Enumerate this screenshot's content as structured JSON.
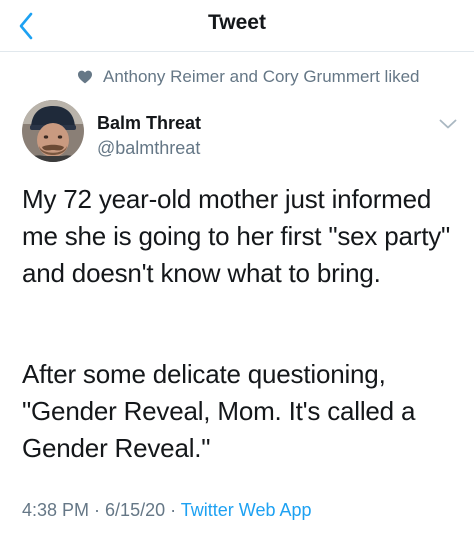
{
  "nav": {
    "title": "Tweet"
  },
  "social_context": {
    "text": "Anthony Reimer and Cory Grummert liked",
    "icon": "heart-icon"
  },
  "author": {
    "display_name": "Balm Threat",
    "handle": "@balmthreat"
  },
  "tweet": {
    "paragraphs": [
      "My 72 year-old mother just informed me she is going to her first \"sex party\" and doesn't know what to bring.",
      "After some delicate questioning, \"Gender Reveal, Mom. It's called a Gender Reveal.\""
    ]
  },
  "meta": {
    "time": "4:38 PM",
    "date": "6/15/20",
    "separator": " · ",
    "source": "Twitter Web App"
  },
  "colors": {
    "accent": "#1da1f2",
    "text_primary": "#14171a",
    "text_secondary": "#657786",
    "divider": "#e1e8ed"
  }
}
